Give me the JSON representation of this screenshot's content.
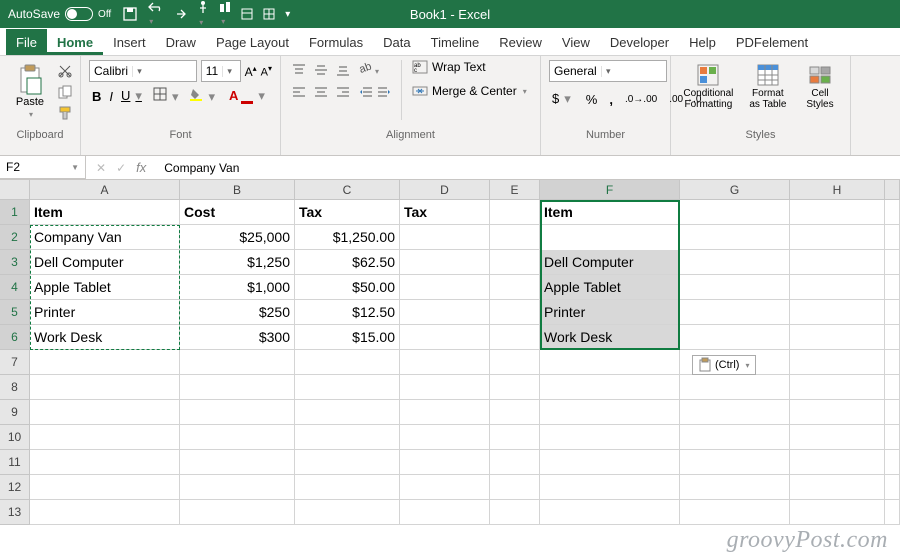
{
  "title_bar": {
    "autosave_label": "AutoSave",
    "autosave_state": "Off",
    "window_title": "Book1 - Excel"
  },
  "tabs": {
    "file": "File",
    "home": "Home",
    "insert": "Insert",
    "draw": "Draw",
    "page_layout": "Page Layout",
    "formulas": "Formulas",
    "data": "Data",
    "timeline": "Timeline",
    "review": "Review",
    "view": "View",
    "developer": "Developer",
    "help": "Help",
    "pdf": "PDFelement"
  },
  "ribbon": {
    "clipboard": {
      "label": "Clipboard",
      "paste": "Paste"
    },
    "font": {
      "label": "Font",
      "name": "Calibri",
      "size": "11"
    },
    "alignment": {
      "label": "Alignment",
      "wrap": "Wrap Text",
      "merge": "Merge & Center"
    },
    "number": {
      "label": "Number",
      "format": "General"
    },
    "styles": {
      "label": "Styles",
      "cond": "Conditional Formatting",
      "table": "Format as Table",
      "cell": "Cell Styles"
    }
  },
  "formula_bar": {
    "name_box": "F2",
    "formula": "Company Van"
  },
  "columns": [
    "A",
    "B",
    "C",
    "D",
    "E",
    "F",
    "G",
    "H"
  ],
  "grid": {
    "headers": {
      "item": "Item",
      "cost": "Cost",
      "tax1": "Tax",
      "tax2": "Tax",
      "item2": "Item"
    },
    "rows": [
      {
        "a": "Company Van",
        "b": "$25,000",
        "c": "$1,250.00",
        "f": "Company Van"
      },
      {
        "a": "Dell Computer",
        "b": "$1,250",
        "c": "$62.50",
        "f": "Dell Computer"
      },
      {
        "a": "Apple Tablet",
        "b": "$1,000",
        "c": "$50.00",
        "f": "Apple Tablet"
      },
      {
        "a": "Printer",
        "b": "$250",
        "c": "$12.50",
        "f": "Printer"
      },
      {
        "a": "Work Desk",
        "b": "$300",
        "c": "$15.00",
        "f": "Work Desk"
      }
    ],
    "row_numbers": [
      "1",
      "2",
      "3",
      "4",
      "5",
      "6",
      "7",
      "8",
      "9",
      "10",
      "11",
      "12",
      "13"
    ]
  },
  "paste_tag": "(Ctrl)",
  "watermark": "groovyPost.com"
}
